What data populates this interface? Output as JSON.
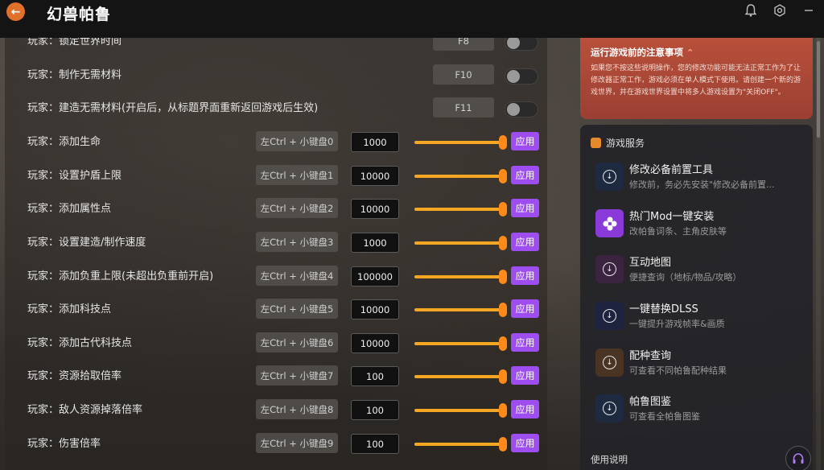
{
  "app": {
    "title": "幻兽帕鲁"
  },
  "titlebar_icons": [
    "back-arrow-icon",
    "notification-icon",
    "settings-icon",
    "minimize-icon"
  ],
  "accent_colors": {
    "orange": "#f5a623",
    "purple": "#9d4df0",
    "notice_red": "#b8503a"
  },
  "cheats": [
    {
      "label": "玩家：锁定世界时间",
      "hotkey": "F8",
      "type": "toggle",
      "on": false
    },
    {
      "label": "玩家：制作无需材料",
      "hotkey": "F10",
      "type": "toggle",
      "on": false
    },
    {
      "label": "玩家：建造无需材料(开启后，从标题界面重新返回游戏后生效)",
      "hotkey": "F11",
      "type": "toggle",
      "on": false
    },
    {
      "label": "玩家：添加生命",
      "hotkey": "左Ctrl + 小键盘0",
      "type": "value",
      "value": "1000",
      "apply": "应用"
    },
    {
      "label": "玩家：设置护盾上限",
      "hotkey": "左Ctrl + 小键盘1",
      "type": "value",
      "value": "10000",
      "apply": "应用"
    },
    {
      "label": "玩家：添加属性点",
      "hotkey": "左Ctrl + 小键盘2",
      "type": "value",
      "value": "10000",
      "apply": "应用"
    },
    {
      "label": "玩家：设置建造/制作速度",
      "hotkey": "左Ctrl + 小键盘3",
      "type": "value",
      "value": "1000",
      "apply": "应用"
    },
    {
      "label": "玩家：添加负重上限(未超出负重前开启)",
      "hotkey": "左Ctrl + 小键盘4",
      "type": "value",
      "value": "100000",
      "apply": "应用"
    },
    {
      "label": "玩家：添加科技点",
      "hotkey": "左Ctrl + 小键盘5",
      "type": "value",
      "value": "10000",
      "apply": "应用"
    },
    {
      "label": "玩家：添加古代科技点",
      "hotkey": "左Ctrl + 小键盘6",
      "type": "value",
      "value": "10000",
      "apply": "应用"
    },
    {
      "label": "玩家：资源拾取倍率",
      "hotkey": "左Ctrl + 小键盘7",
      "type": "value",
      "value": "100",
      "apply": "应用"
    },
    {
      "label": "玩家：敌人资源掉落倍率",
      "hotkey": "左Ctrl + 小键盘8",
      "type": "value",
      "value": "100",
      "apply": "应用"
    },
    {
      "label": "玩家：伤害倍率",
      "hotkey": "左Ctrl + 小键盘9",
      "type": "value",
      "value": "100",
      "apply": "应用"
    }
  ],
  "notice": {
    "title": "运行游戏前的注意事项",
    "text": "如果您不按这些说明操作，您的修改功能可能无法正常工作为了让修改器正常工作，游戏必须在单人模式下使用。请创建一个新的游戏世界，并在游戏世界设置中将多人游戏设置为\"关闭OFF\"。"
  },
  "services": {
    "header": "游戏服务",
    "items": [
      {
        "title": "修改必备前置工具",
        "sub": "修改前，务必先安装\"修改必备前置...",
        "icon": "download-icon",
        "bg": "#1e2a40"
      },
      {
        "title": "热门Mod一键安装",
        "sub": "改帕鲁词条、主角皮肤等",
        "icon": "flower-icon",
        "bg": "#8a3ad8"
      },
      {
        "title": "互动地图",
        "sub": "便捷查询（地标/物品/攻略）",
        "icon": "download-icon",
        "bg": "#3a2440"
      },
      {
        "title": "一键替换DLSS",
        "sub": "一键提升游戏帧率&画质",
        "icon": "download-icon",
        "bg": "#1e2440"
      },
      {
        "title": "配种查询",
        "sub": "可查看不同帕鲁配种结果",
        "icon": "download-icon",
        "bg": "#4a3424"
      },
      {
        "title": "帕鲁图鉴",
        "sub": "可查看全帕鲁图鉴",
        "icon": "download-icon",
        "bg": "#1e2a40"
      }
    ]
  },
  "usage": {
    "label": "使用说明",
    "icon": "headset-icon"
  }
}
